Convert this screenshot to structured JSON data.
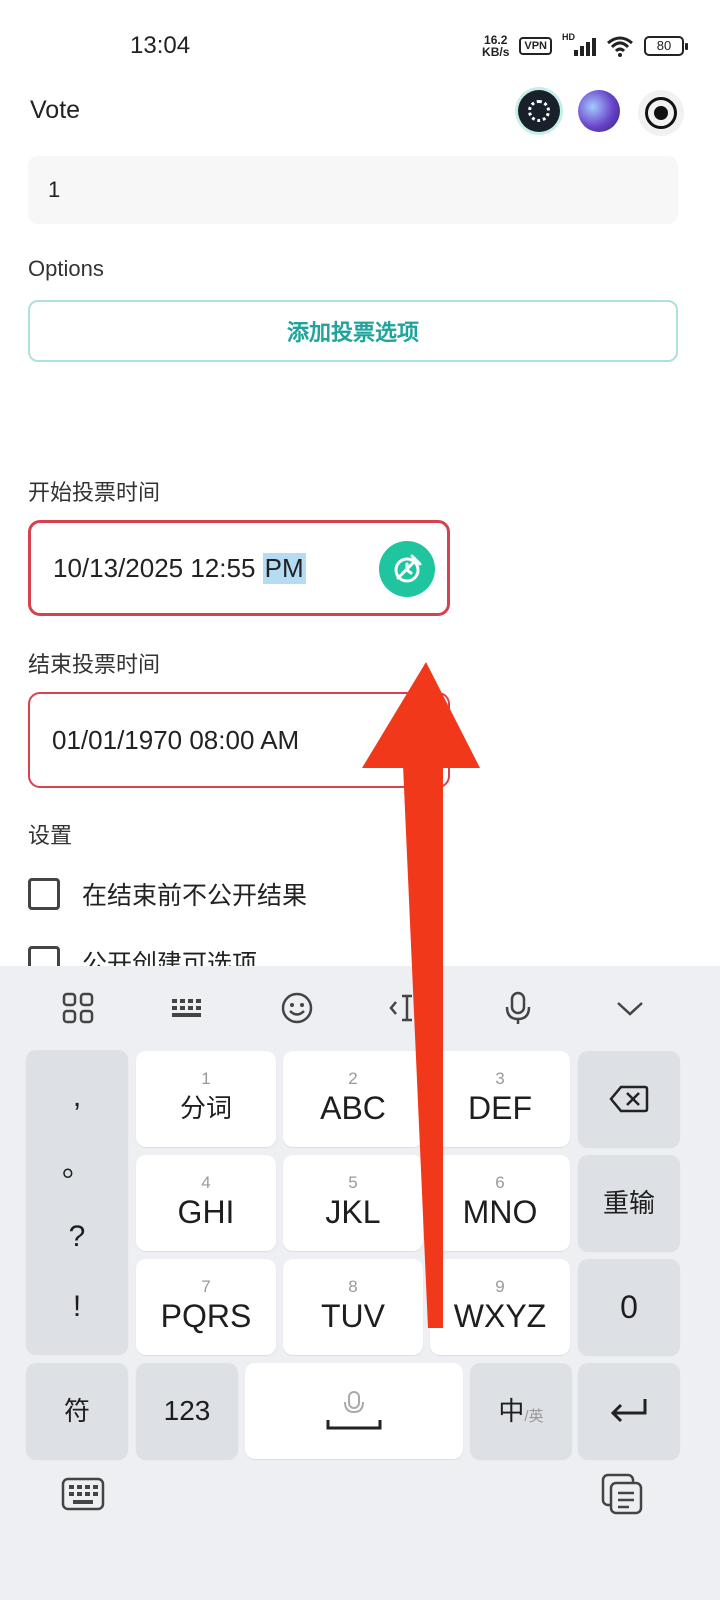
{
  "status": {
    "time": "13:04",
    "net_speed_top": "16.2",
    "net_speed_bottom": "KB/s",
    "vpn": "VPN",
    "hd": "HD",
    "battery": "80"
  },
  "header": {
    "title": "Vote",
    "icons": [
      "dots-app-icon",
      "galaxy-avatar-icon",
      "record-icon"
    ]
  },
  "form": {
    "vote_value": "1",
    "options_label": "Options",
    "add_option_label": "添加投票选项",
    "start_label": "开始投票时间",
    "start_value_main": "10/13/2025 12:55 ",
    "start_value_selected": "PM",
    "end_label": "结束投票时间",
    "end_value": "01/01/1970 08:00 AM",
    "settings_label": "设置",
    "settings": [
      {
        "label": "在结束前不公开结果",
        "checked": false
      },
      {
        "label": "公开创建可选项",
        "checked": false
      }
    ]
  },
  "keyboard": {
    "toolbar": [
      "grid-icon",
      "keyboard-icon",
      "emoji-icon",
      "cursor-icon",
      "mic-icon",
      "collapse-icon"
    ],
    "punct": [
      ",",
      "。",
      "?",
      "!"
    ],
    "keys": [
      {
        "num": "1",
        "label": "分词"
      },
      {
        "num": "2",
        "label": "ABC"
      },
      {
        "num": "3",
        "label": "DEF"
      },
      {
        "num": "4",
        "label": "GHI"
      },
      {
        "num": "5",
        "label": "JKL"
      },
      {
        "num": "6",
        "label": "MNO"
      },
      {
        "num": "7",
        "label": "PQRS"
      },
      {
        "num": "8",
        "label": "TUV"
      },
      {
        "num": "9",
        "label": "WXYZ"
      }
    ],
    "reinput": "重输",
    "zero": "0",
    "symbols": "符",
    "numbers": "123",
    "lang_main": "中",
    "lang_sub": "/英"
  },
  "colors": {
    "accent_teal": "#1fa39a",
    "error_red": "#d8424c",
    "clock_green": "#1fc59f",
    "arrow_red": "#f2381b"
  }
}
